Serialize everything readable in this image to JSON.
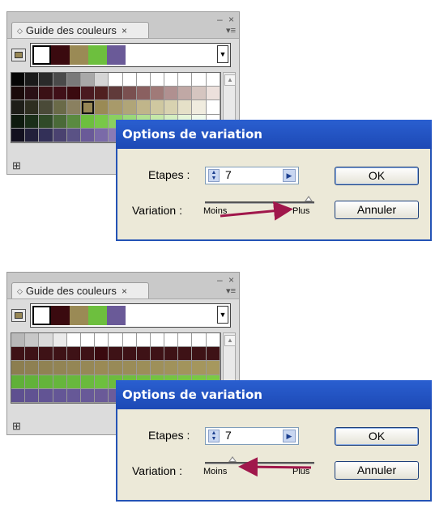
{
  "panel": {
    "tab_label": "Guide des couleurs",
    "tab_close": "×",
    "window_controls": "– ×",
    "menu_icon": "▾≡",
    "harmony_colors": [
      "#ffffff",
      "#3a0a0f",
      "#9a8a55",
      "#6dbf3e",
      "#6a5a98"
    ],
    "dropdown_icon": "chevron-down-icon",
    "grid_icon_label": "⊞"
  },
  "dialog": {
    "title": "Options de variation",
    "steps_label": "Etapes :",
    "steps_value": "7",
    "variation_label": "Variation :",
    "min_label": "Moins",
    "max_label": "Plus",
    "ok_label": "OK",
    "cancel_label": "Annuler"
  },
  "scenes": [
    {
      "slider_position": 0.95,
      "arrow": "towards-plus"
    },
    {
      "slider_position": 0.25,
      "arrow": "towards-moins"
    }
  ],
  "grid_top": [
    [
      "#050505",
      "#1a1a1a",
      "#2a2a2a",
      "#4a4a4a",
      "#7a7a7a",
      "#a8a8a8",
      "#d5d5d5",
      "#ffffff",
      "#ffffff",
      "#ffffff",
      "#ffffff",
      "#ffffff",
      "#ffffff",
      "#ffffff",
      "#ffffff"
    ],
    [
      "#1a0a0a",
      "#2a1015",
      "#3a1015",
      "#401018",
      "#3a0a0f",
      "#4a1a20",
      "#502020",
      "#603a3a",
      "#7a5050",
      "#8a6060",
      "#a07a78",
      "#b09090",
      "#c0a8a5",
      "#d5c5c0",
      "#ece0dc"
    ],
    [
      "#1e1e18",
      "#2e2e20",
      "#4a4a38",
      "#6a6a48",
      "#8a8060",
      "#978755",
      "#9a8a55",
      "#a89a6a",
      "#b0a578",
      "#c0b58a",
      "#cfc8a0",
      "#d8d2b0",
      "#e5e0c8",
      "#f0ecdf",
      "#ffffff"
    ],
    [
      "#0e1a0e",
      "#1a2e18",
      "#304a28",
      "#4a6a38",
      "#5a8a40",
      "#6dbf3e",
      "#78c848",
      "#8ad060",
      "#9ad878",
      "#b0e090",
      "#c5e8a8",
      "#d5efc0",
      "#e5f5d8",
      "#f0faec",
      "#ffffff"
    ],
    [
      "#12101e",
      "#22203a",
      "#333058",
      "#4a4270",
      "#5a5285",
      "#6a5a98",
      "#7a6aa8",
      "#8a7ab5",
      "#9a8ac0",
      "#aa9ac8",
      "#bab0d5",
      "#ccc2e0",
      "#dcd5eb",
      "#ede8f5",
      "#ffffff"
    ]
  ],
  "grid_bottom": [
    [
      "#b8b8b8",
      "#c8c8c8",
      "#dadada",
      "#ebebeb",
      "#ffffff",
      "#ffffff",
      "#ffffff",
      "#ffffff",
      "#ffffff",
      "#ffffff",
      "#ffffff",
      "#ffffff",
      "#ffffff",
      "#ffffff",
      "#ffffff"
    ],
    [
      "#3e1216",
      "#3e1216",
      "#3e1216",
      "#3e1216",
      "#3e1216",
      "#3e1216",
      "#3a0a0f",
      "#3e1216",
      "#3e1216",
      "#3e1216",
      "#3e1216",
      "#3e1216",
      "#3e1216",
      "#3e1216",
      "#3e1216"
    ],
    [
      "#8c7e50",
      "#8e8052",
      "#908253",
      "#928454",
      "#948655",
      "#968856",
      "#9a8a55",
      "#988a57",
      "#9a8c58",
      "#9c8e59",
      "#9e905a",
      "#a0925b",
      "#a2945c",
      "#a4965d",
      "#a6985e"
    ],
    [
      "#60b038",
      "#62b23a",
      "#64b43b",
      "#66b63c",
      "#68b83d",
      "#6aba3d",
      "#6dbf3e",
      "#6cbc3e",
      "#6ebe3f",
      "#70c040",
      "#72c241",
      "#74c442",
      "#76c643",
      "#78c844",
      "#7aca45"
    ],
    [
      "#5e5090",
      "#605292",
      "#625494",
      "#645696",
      "#665897",
      "#685998",
      "#6a5a98",
      "#6c5c9a",
      "#6e5e9c",
      "#70609e",
      "#7262a0",
      "#7464a2",
      "#7666a4",
      "#7868a6",
      "#7a6aa8"
    ]
  ]
}
